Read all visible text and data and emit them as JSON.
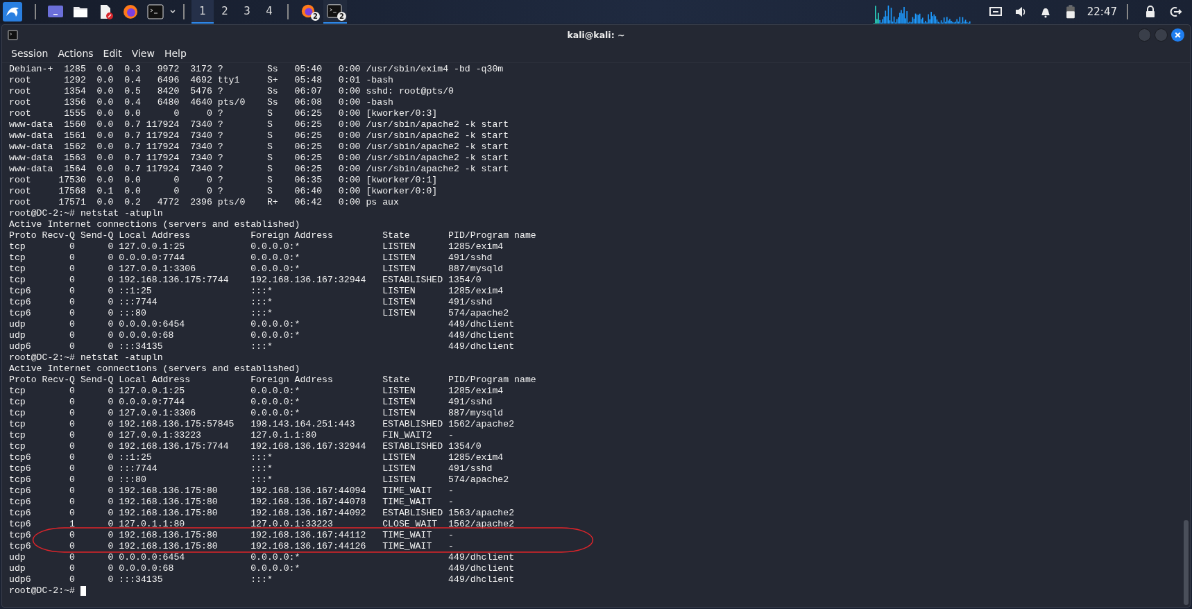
{
  "taskbar": {
    "workspaces": [
      {
        "label": "1",
        "selected": true
      },
      {
        "label": "2",
        "selected": false
      },
      {
        "label": "3",
        "selected": false
      },
      {
        "label": "4",
        "selected": false
      }
    ],
    "tasks": [
      {
        "kind": "browser",
        "badge": "2",
        "selected": false
      },
      {
        "kind": "terminal",
        "badge": "2",
        "selected": true
      }
    ],
    "clock": "22:47"
  },
  "window": {
    "title": "kali@kali: ~",
    "menu": [
      "Session",
      "Actions",
      "Edit",
      "View",
      "Help"
    ]
  },
  "terminal": {
    "lines": [
      "Debian-+  1285  0.0  0.3   9972  3172 ?        Ss   05:40   0:00 /usr/sbin/exim4 -bd -q30m",
      "root      1292  0.0  0.4   6496  4692 tty1     S+   05:48   0:01 -bash",
      "root      1354  0.0  0.5   8420  5476 ?        Ss   06:07   0:00 sshd: root@pts/0",
      "root      1356  0.0  0.4   6480  4640 pts/0    Ss   06:08   0:00 -bash",
      "root      1555  0.0  0.0      0     0 ?        S    06:25   0:00 [kworker/0:3]",
      "www-data  1560  0.0  0.7 117924  7340 ?        S    06:25   0:00 /usr/sbin/apache2 -k start",
      "www-data  1561  0.0  0.7 117924  7340 ?        S    06:25   0:00 /usr/sbin/apache2 -k start",
      "www-data  1562  0.0  0.7 117924  7340 ?        S    06:25   0:00 /usr/sbin/apache2 -k start",
      "www-data  1563  0.0  0.7 117924  7340 ?        S    06:25   0:00 /usr/sbin/apache2 -k start",
      "www-data  1564  0.0  0.7 117924  7340 ?        S    06:25   0:00 /usr/sbin/apache2 -k start",
      "root     17530  0.0  0.0      0     0 ?        S    06:35   0:00 [kworker/0:1]",
      "root     17568  0.1  0.0      0     0 ?        S    06:40   0:00 [kworker/0:0]",
      "root     17571  0.0  0.2   4772  2396 pts/0    R+   06:42   0:00 ps aux",
      "root@DC-2:~# netstat -atupln",
      "Active Internet connections (servers and established)",
      "Proto Recv-Q Send-Q Local Address           Foreign Address         State       PID/Program name",
      "tcp        0      0 127.0.0.1:25            0.0.0.0:*               LISTEN      1285/exim4",
      "tcp        0      0 0.0.0.0:7744            0.0.0.0:*               LISTEN      491/sshd",
      "tcp        0      0 127.0.0.1:3306          0.0.0.0:*               LISTEN      887/mysqld",
      "tcp        0      0 192.168.136.175:7744    192.168.136.167:32944   ESTABLISHED 1354/0",
      "tcp6       0      0 ::1:25                  :::*                    LISTEN      1285/exim4",
      "tcp6       0      0 :::7744                 :::*                    LISTEN      491/sshd",
      "tcp6       0      0 :::80                   :::*                    LISTEN      574/apache2",
      "udp        0      0 0.0.0.0:6454            0.0.0.0:*                           449/dhclient",
      "udp        0      0 0.0.0.0:68              0.0.0.0:*                           449/dhclient",
      "udp6       0      0 :::34135                :::*                                449/dhclient",
      "root@DC-2:~# netstat -atupln",
      "Active Internet connections (servers and established)",
      "Proto Recv-Q Send-Q Local Address           Foreign Address         State       PID/Program name",
      "tcp        0      0 127.0.0.1:25            0.0.0.0:*               LISTEN      1285/exim4",
      "tcp        0      0 0.0.0.0:7744            0.0.0.0:*               LISTEN      491/sshd",
      "tcp        0      0 127.0.0.1:3306          0.0.0.0:*               LISTEN      887/mysqld",
      "tcp        0      0 192.168.136.175:57845   198.143.164.251:443     ESTABLISHED 1562/apache2",
      "tcp        0      0 127.0.0.1:33223         127.0.1.1:80            FIN_WAIT2   -",
      "tcp        0      0 192.168.136.175:7744    192.168.136.167:32944   ESTABLISHED 1354/0",
      "tcp6       0      0 ::1:25                  :::*                    LISTEN      1285/exim4",
      "tcp6       0      0 :::7744                 :::*                    LISTEN      491/sshd",
      "tcp6       0      0 :::80                   :::*                    LISTEN      574/apache2",
      "tcp6       0      0 192.168.136.175:80      192.168.136.167:44094   TIME_WAIT   -",
      "tcp6       0      0 192.168.136.175:80      192.168.136.167:44078   TIME_WAIT   -",
      "tcp6       0      0 192.168.136.175:80      192.168.136.167:44092   ESTABLISHED 1563/apache2",
      "tcp6       1      0 127.0.1.1:80            127.0.0.1:33223         CLOSE_WAIT  1562/apache2",
      "tcp6       0      0 192.168.136.175:80      192.168.136.167:44112   TIME_WAIT   -",
      "tcp6       0      0 192.168.136.175:80      192.168.136.167:44126   TIME_WAIT   -",
      "udp        0      0 0.0.0.0:6454            0.0.0.0:*                           449/dhclient",
      "udp        0      0 0.0.0.0:68              0.0.0.0:*                           449/dhclient",
      "udp6       0      0 :::34135                :::*                                449/dhclient"
    ],
    "prompt": "root@DC-2:~#"
  }
}
